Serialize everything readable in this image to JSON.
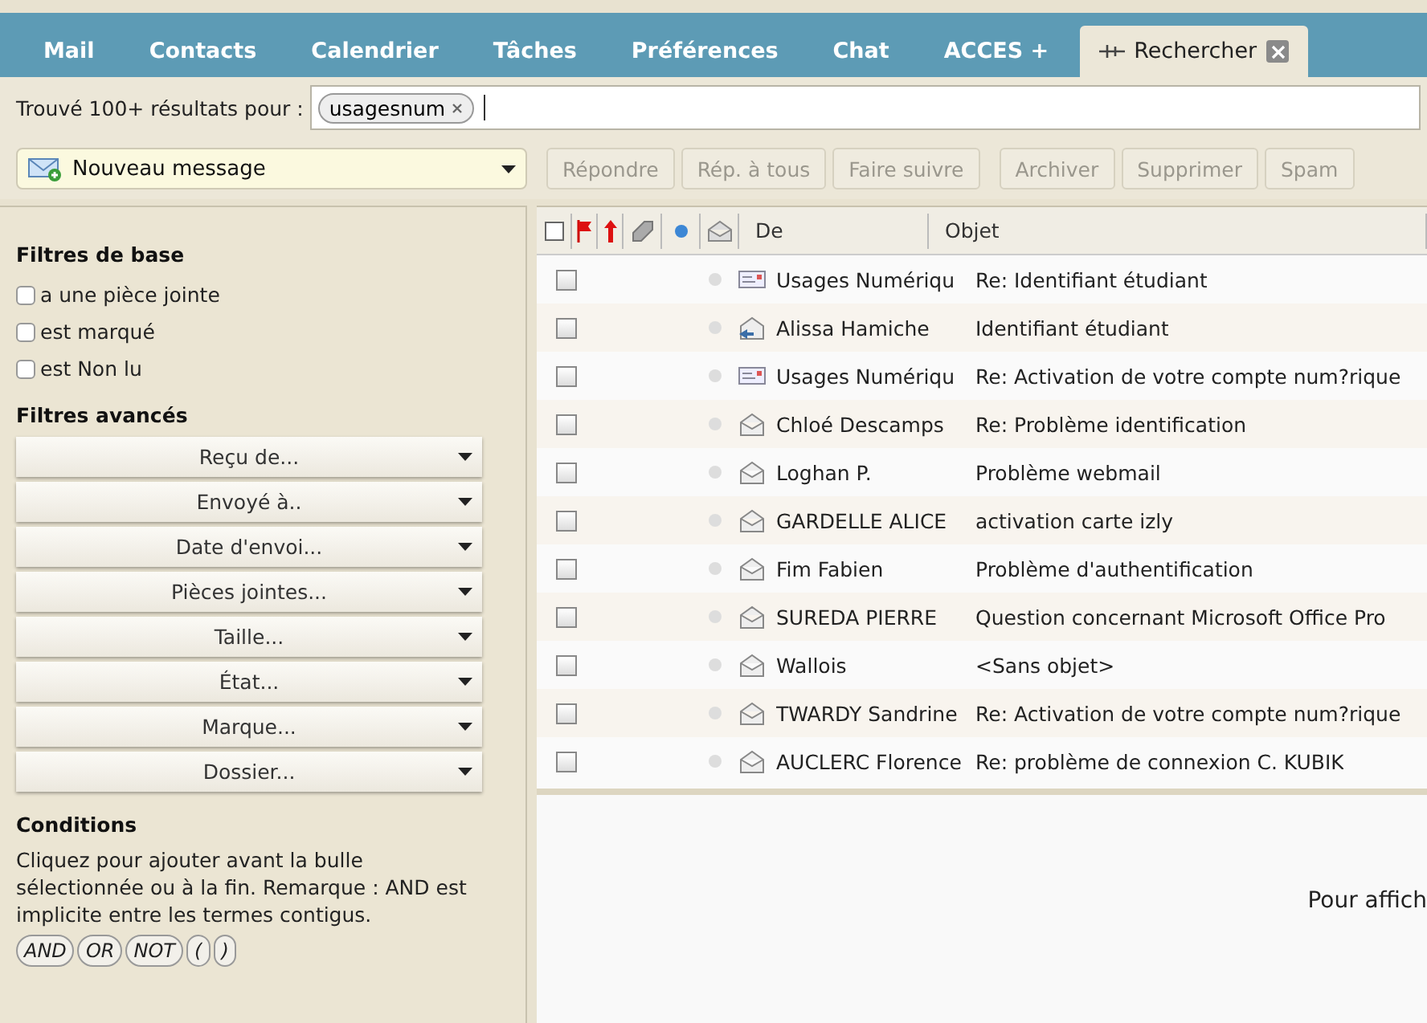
{
  "tabs": [
    {
      "label": "Mail",
      "selected": false
    },
    {
      "label": "Contacts",
      "selected": false
    },
    {
      "label": "Calendrier",
      "selected": false
    },
    {
      "label": "Tâches",
      "selected": false
    },
    {
      "label": "Préférences",
      "selected": false
    },
    {
      "label": "Chat",
      "selected": false
    },
    {
      "label": "ACCES +",
      "selected": false
    },
    {
      "label": "Rechercher",
      "selected": true,
      "closable": true
    }
  ],
  "search": {
    "label": "Trouvé 100+ résultats pour :",
    "tokens": [
      "usagesnum"
    ]
  },
  "toolbar": {
    "new_message": "Nouveau message",
    "buttons": [
      {
        "label": "Répondre",
        "disabled": true
      },
      {
        "label": "Rép. à tous",
        "disabled": true
      },
      {
        "label": "Faire suivre",
        "disabled": true
      },
      {
        "label": "Archiver",
        "disabled": true
      },
      {
        "label": "Supprimer",
        "disabled": true
      },
      {
        "label": "Spam",
        "disabled": true
      }
    ]
  },
  "sidebar": {
    "basic_title": "Filtres de base",
    "basic_filters": [
      {
        "label": "a une pièce jointe",
        "checked": false
      },
      {
        "label": "est marqué",
        "checked": false
      },
      {
        "label": "est Non lu",
        "checked": false
      }
    ],
    "advanced_title": "Filtres avancés",
    "advanced_filters": [
      "Reçu de...",
      "Envoyé à..",
      "Date d'envoi...",
      "Pièces jointes...",
      "Taille...",
      "État...",
      "Marque...",
      "Dossier..."
    ],
    "conditions_title": "Conditions",
    "conditions_text": "Cliquez pour ajouter avant la bulle sélectionnée ou à la fin. Remarque : AND est implicite entre les termes contigus.",
    "operators": [
      "AND",
      "OR",
      "NOT",
      "(",
      ")"
    ]
  },
  "table": {
    "all_checked": false,
    "columns": [
      "De",
      "Objet"
    ],
    "rows": [
      {
        "kind": "notice",
        "from": "Usages Numériqu",
        "subject": "Re: Identifiant étudiant",
        "checked": false
      },
      {
        "kind": "replied",
        "from": "Alissa Hamiche",
        "subject": "Identifiant étudiant",
        "checked": false
      },
      {
        "kind": "notice",
        "from": "Usages Numériqu",
        "subject": "Re: Activation de votre compte num?rique",
        "checked": false
      },
      {
        "kind": "read",
        "from": "Chloé Descamps",
        "subject": "Re: Problème identification",
        "checked": false
      },
      {
        "kind": "read",
        "from": "Loghan P.",
        "subject": "Problème webmail",
        "checked": false
      },
      {
        "kind": "read",
        "from": "GARDELLE ALICE",
        "subject": "activation carte izly",
        "checked": false
      },
      {
        "kind": "read",
        "from": "Fim Fabien",
        "subject": "Problème d'authentification",
        "checked": false
      },
      {
        "kind": "read",
        "from": "SUREDA PIERRE",
        "subject": "Question concernant Microsoft Office Pro",
        "checked": false
      },
      {
        "kind": "read",
        "from": "Wallois",
        "subject": "<Sans objet>",
        "checked": false
      },
      {
        "kind": "read",
        "from": "TWARDY Sandrine",
        "subject": "Re: Activation de votre compte num?rique",
        "checked": false
      },
      {
        "kind": "read",
        "from": "AUCLERC Florence",
        "subject": "Re: problème de connexion C. KUBIK",
        "checked": false
      }
    ]
  },
  "preview": {
    "message": "Pour affich"
  }
}
